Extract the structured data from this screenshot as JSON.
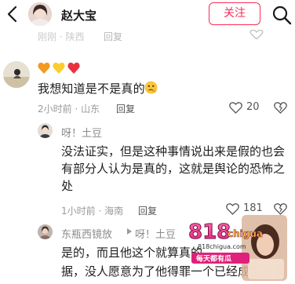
{
  "header": {
    "back_icon": "chevron-left-icon",
    "username": "赵大宝",
    "follow_label": "关注",
    "search_icon": "search-icon"
  },
  "prev_comment": {
    "time_location": "刚刚 · 陕西",
    "reply_label": "回复"
  },
  "comment": {
    "emojis": [
      "orange-heart",
      "yellow-heart",
      "red-heart"
    ],
    "text": "我想知道是不是真的",
    "time_location": "2小时前 · 山东",
    "reply_label": "回复",
    "like_count": "20"
  },
  "replies": [
    {
      "username": "呀！土豆",
      "lines": [
        "没法证实，但是这种事情说出来是假的也会",
        "有部分人认为是真的，这就是舆论的恐怖之",
        "处"
      ],
      "time_location": "1小时前 · 海南",
      "reply_label": "回复",
      "like_count": "181"
    },
    {
      "username": "东瓶西镜放",
      "reply_to": "呀！土豆",
      "lines": [
        "是的，而且他这个就算真的",
        "据，没人愿意为了他得罪一个已经成型的演"
      ]
    }
  ],
  "watermark": {
    "number": "818",
    "brand": "chigua",
    "site": "818chigua.com",
    "tagline": "每天都有瓜"
  },
  "colors": {
    "accent": "#ff2a55",
    "meta_text": "#9a9a9a",
    "body_text": "#1e1e1e"
  }
}
